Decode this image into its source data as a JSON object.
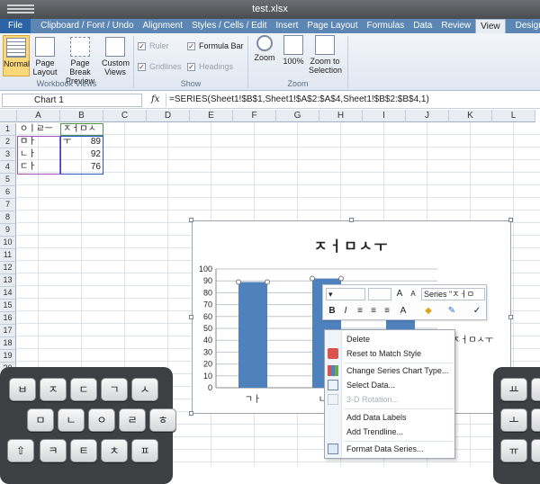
{
  "window": {
    "title": "test.xlsx"
  },
  "ribbon_tabs": [
    "File",
    "Clipboard / Font / Undo",
    "Alignment",
    "Styles / Cells / Edit",
    "Insert",
    "Page Layout",
    "Formulas",
    "Data",
    "Review",
    "View",
    "Design",
    "La"
  ],
  "ribbon": {
    "workbook_views": {
      "label": "Workbook Views",
      "normal": "Normal",
      "page_layout": "Page Layout",
      "page_break": "Page Break Preview",
      "custom_views": "Custom Views"
    },
    "show": {
      "label": "Show",
      "ruler": "Ruler",
      "formula_bar": "Formula Bar",
      "gridlines": "Gridlines",
      "headings": "Headings"
    },
    "zoom": {
      "label": "Zoom",
      "zoom": "Zoom",
      "hundred": "100%",
      "to_selection": "Zoom to Selection"
    }
  },
  "formula_bar": {
    "name_box": "Chart 1",
    "fx": "fx",
    "formula": "=SERIES(Sheet1!$B$1,Sheet1!$A$2:$A$4,Sheet1!$B$2:$B$4,1)"
  },
  "columns": [
    "A",
    "B",
    "C",
    "D",
    "E",
    "F",
    "G",
    "H",
    "I",
    "J",
    "K",
    "L"
  ],
  "rows": [
    "1",
    "2",
    "3",
    "4",
    "5",
    "6",
    "7",
    "8",
    "9",
    "10",
    "11",
    "12",
    "13",
    "14",
    "15",
    "16",
    "17",
    "18",
    "19",
    "20",
    "21",
    "22",
    "23",
    "24",
    "25",
    "26"
  ],
  "cells": {
    "a1": "ㅇㅣㄹㅡㅁ",
    "b1": "ㅈㅓㅁㅅㅜ",
    "a2": "ㄱㅏ",
    "b2": "89",
    "a3": "ㄴㅏ",
    "b3": "92",
    "a4": "ㄷㅏ",
    "b4": "76"
  },
  "chart_data": {
    "type": "bar",
    "title": "ㅈㅓㅁㅅㅜ",
    "categories": [
      "ㄱㅏ",
      "ㄴㅏ",
      "ㄷㅏ"
    ],
    "series": [
      {
        "name": "ㅈㅓㅁㅅㅜ",
        "values": [
          89,
          92,
          76
        ],
        "color": "#4f81bd"
      }
    ],
    "ylim": [
      0,
      100
    ],
    "yticks": [
      "0",
      "10",
      "20",
      "30",
      "40",
      "50",
      "60",
      "70",
      "80",
      "90",
      "100"
    ],
    "grid": true,
    "legend": "right"
  },
  "mini_toolbar": {
    "series_dropdown": "Series \"ㅈㅓㅁ"
  },
  "context_menu": [
    "Delete",
    "Reset to Match Style",
    "Change Series Chart Type...",
    "Select Data...",
    "3-D Rotation...",
    "Add Data Labels",
    "Add Trendline...",
    "Format Data Series..."
  ],
  "keyboard_left": [
    [
      "ㅂ",
      "ㅈ",
      "ㄷ",
      "ㄱ",
      "ㅅ"
    ],
    [
      "ㅁ",
      "ㄴ",
      "ㅇ",
      "ㄹ",
      "ㅎ"
    ],
    [
      "ㅋ",
      "ㅌ",
      "ㅊ",
      "ㅍ"
    ]
  ],
  "keyboard_right": [
    [
      "ㅛ",
      "ㅕ"
    ],
    [
      "ㅗ",
      "ㅓ"
    ],
    [
      "ㅠ",
      "ㅜ"
    ]
  ]
}
